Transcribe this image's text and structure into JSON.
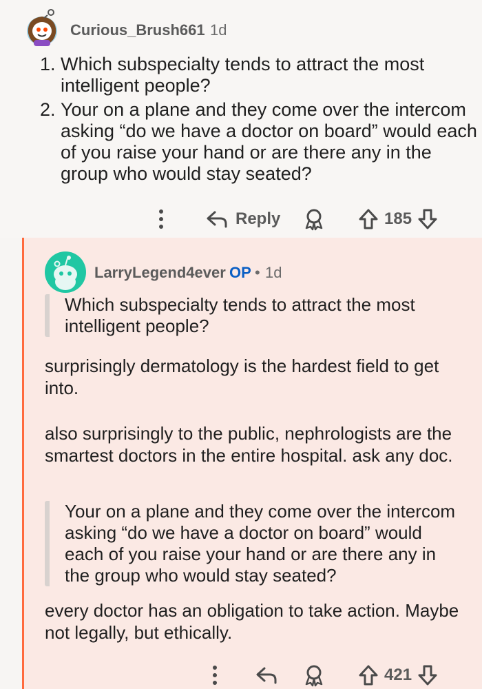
{
  "top_comment": {
    "username": "Curious_Brush661",
    "age": "1d",
    "questions": [
      "Which subspecialty tends to attract the most intelligent people?",
      "Your on a plane and they come over the intercom asking “do we have a doctor on board” would each of you raise your hand or are there any in the group who would stay seated?"
    ],
    "actions": {
      "more_icon": "more-vertical-icon",
      "reply_label": "Reply",
      "award_icon": "award-icon",
      "upvote_icon": "upvote-arrow-icon",
      "score": "185",
      "downvote_icon": "downvote-arrow-icon"
    }
  },
  "reply_comment": {
    "username": "LarryLegend4ever",
    "op_tag": "OP",
    "separator": "•",
    "age": "1d",
    "quote1": "Which subspecialty tends to attract the most intelligent people?",
    "para1": "surprisingly dermatology is the hardest field to get into.",
    "para2": "also surprisingly to the public, nephrologists are the smartest doctors in the entire hospital. ask any doc.",
    "quote2": "Your on a plane and they come over the intercom asking “do we have a doctor on board” would each of you raise your hand or are there any in the group who would stay seated?",
    "para3": "every doctor has an obligation to take action. Maybe not legally, but ethically.",
    "actions": {
      "more_icon": "more-vertical-icon",
      "reply_icon": "reply-arrow-icon",
      "award_icon": "award-icon",
      "upvote_icon": "upvote-arrow-icon",
      "score": "421",
      "downvote_icon": "downvote-arrow-icon"
    }
  },
  "colors": {
    "thread_line": "#ff6a3d",
    "reply_background": "#fbe9e4",
    "op_tag": "#0a5fc4",
    "avatar_teal": "#20c7a3"
  }
}
